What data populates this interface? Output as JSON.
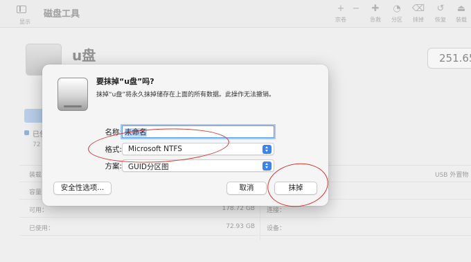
{
  "toolbar": {
    "view_label": "显示",
    "title": "磁盘工具",
    "buttons": [
      {
        "icon": "plus-icon",
        "glyph": "+",
        "label": "宗卷"
      },
      {
        "icon": "minus-icon",
        "glyph": "−",
        "label": ""
      },
      {
        "icon": "first-aid-icon",
        "glyph": "✚",
        "label": "急救"
      },
      {
        "icon": "partition-icon",
        "glyph": "◔",
        "label": "分区"
      },
      {
        "icon": "erase-icon",
        "glyph": "⌫",
        "label": "抹掉"
      },
      {
        "icon": "restore-icon",
        "glyph": "↺",
        "label": "恢复"
      },
      {
        "icon": "mount-icon",
        "glyph": "⏏",
        "label": "装载"
      }
    ]
  },
  "background": {
    "disk_name": "u盘",
    "capacity": "251.65",
    "legend_label": "已使",
    "legend_sub": "72",
    "info_rows": [
      {
        "k": "装载",
        "v": "",
        "k2": "",
        "v2": "USB 外置物"
      },
      {
        "k": "容量",
        "v": "",
        "k2": "",
        "v2": ""
      },
      {
        "k": "可用：",
        "v": "178.72 GB",
        "k2": "连接：",
        "v2": ""
      },
      {
        "k": "已使用：",
        "v": "72.93 GB",
        "k2": "设备：",
        "v2": ""
      }
    ]
  },
  "dialog": {
    "title": "要抹掉“u盘”吗?",
    "description": "抹掉“u盘”将永久抹掉储存在上面的所有数据。此操作无法撤销。",
    "name_label": "名称:",
    "name_value": "未命名",
    "format_label": "格式:",
    "format_value": "Microsoft NTFS",
    "scheme_label": "方案:",
    "scheme_value": "GUID分区图",
    "security_button": "安全性选项...",
    "cancel_button": "取消",
    "erase_button": "抹掉"
  },
  "colors": {
    "accent": "#3a84f3",
    "annotation": "#d8342c",
    "sheet_bg": "#f5f5f5"
  }
}
